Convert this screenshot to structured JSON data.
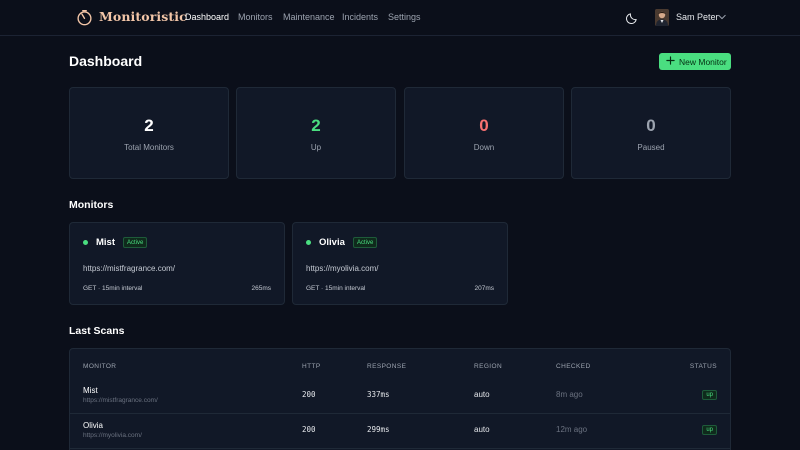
{
  "app": {
    "name": "Monitoristic"
  },
  "nav": {
    "items": [
      "Dashboard",
      "Monitors",
      "Maintenance",
      "Incidents",
      "Settings"
    ],
    "active": "Dashboard"
  },
  "user": {
    "name": "Sam Peter"
  },
  "page": {
    "title": "Dashboard",
    "new_button": "New Monitor"
  },
  "stats": [
    {
      "value": "2",
      "label": "Total Monitors",
      "color": "#ffffff"
    },
    {
      "value": "2",
      "label": "Up",
      "color": "#4ade80"
    },
    {
      "value": "0",
      "label": "Down",
      "color": "#f87171"
    },
    {
      "value": "0",
      "label": "Paused",
      "color": "#9ca3af"
    }
  ],
  "monitors_section": {
    "title": "Monitors"
  },
  "monitors": [
    {
      "name": "Mist",
      "badge": "Active",
      "url": "https://mistfragrance.com/",
      "meta": "GET · 15min interval",
      "response": "265ms"
    },
    {
      "name": "Olivia",
      "badge": "Active",
      "url": "https://myolivia.com/",
      "meta": "GET · 15min interval",
      "response": "207ms"
    }
  ],
  "scans": {
    "title": "Last Scans",
    "columns": [
      "MONITOR",
      "HTTP",
      "RESPONSE",
      "REGION",
      "CHECKED",
      "STATUS"
    ],
    "rows": [
      {
        "name": "Mist",
        "url": "https://mistfragrance.com/",
        "http": "200",
        "response": "337ms",
        "region": "auto",
        "checked": "8m ago",
        "status": "up"
      },
      {
        "name": "Olivia",
        "url": "https://myolivia.com/",
        "http": "200",
        "response": "299ms",
        "region": "auto",
        "checked": "12m ago",
        "status": "up"
      }
    ]
  },
  "colors": {
    "accent": "#4ade80",
    "background": "#0b0f1a",
    "card": "#111827",
    "brand": "#f3c6a8"
  },
  "icons": {
    "logo": "stopwatch-logo-icon",
    "theme": "moon-icon",
    "chevron": "chevron-down-icon",
    "add": "plus-icon"
  }
}
